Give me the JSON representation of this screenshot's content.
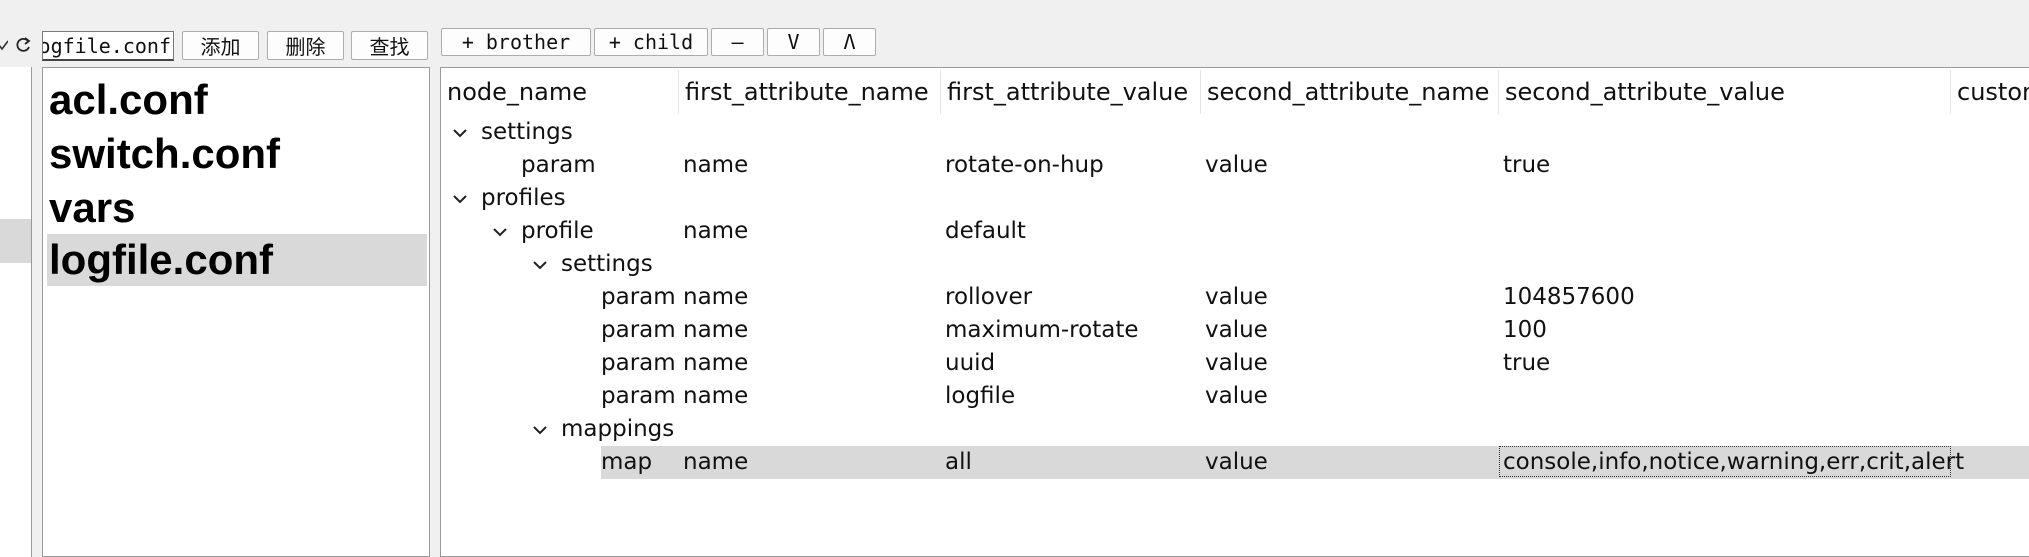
{
  "toolbar": {
    "file_input_value": "logfile.conf",
    "add_label": "添加",
    "delete_label": "删除",
    "find_label": "查找",
    "add_brother_label": "+ brother",
    "add_child_label": "+ child",
    "collapse_label": "—",
    "move_down_label": "V",
    "move_up_label": "Λ"
  },
  "file_list": {
    "items": [
      "acl.conf",
      "switch.conf",
      "vars",
      "logfile.conf"
    ],
    "selected": "logfile.conf"
  },
  "tree": {
    "columns": [
      "node_name",
      "first_attribute_name",
      "first_attribute_value",
      "second_attribute_name",
      "second_attribute_value",
      "custom"
    ],
    "rows": [
      {
        "depth": 0,
        "expandable": true,
        "node": "settings",
        "a1n": "",
        "a1v": "",
        "a2n": "",
        "a2v": ""
      },
      {
        "depth": 1,
        "expandable": false,
        "node": "param",
        "a1n": "name",
        "a1v": "rotate-on-hup",
        "a2n": "value",
        "a2v": "true"
      },
      {
        "depth": 0,
        "expandable": true,
        "node": "profiles",
        "a1n": "",
        "a1v": "",
        "a2n": "",
        "a2v": ""
      },
      {
        "depth": 1,
        "expandable": true,
        "node": "profile",
        "a1n": "name",
        "a1v": "default",
        "a2n": "",
        "a2v": ""
      },
      {
        "depth": 2,
        "expandable": true,
        "node": "settings",
        "a1n": "",
        "a1v": "",
        "a2n": "",
        "a2v": ""
      },
      {
        "depth": 3,
        "expandable": false,
        "node": "param",
        "a1n": "name",
        "a1v": "rollover",
        "a2n": "value",
        "a2v": "104857600"
      },
      {
        "depth": 3,
        "expandable": false,
        "node": "param",
        "a1n": "name",
        "a1v": "maximum-rotate",
        "a2n": "value",
        "a2v": "100"
      },
      {
        "depth": 3,
        "expandable": false,
        "node": "param",
        "a1n": "name",
        "a1v": "uuid",
        "a2n": "value",
        "a2v": "true"
      },
      {
        "depth": 3,
        "expandable": false,
        "node": "param",
        "a1n": "name",
        "a1v": "logfile",
        "a2n": "value",
        "a2v": ""
      },
      {
        "depth": 2,
        "expandable": true,
        "node": "mappings",
        "a1n": "",
        "a1v": "",
        "a2n": "",
        "a2v": ""
      },
      {
        "depth": 3,
        "expandable": false,
        "node": "map",
        "a1n": "name",
        "a1v": "all",
        "a2n": "value",
        "a2v": "console,info,notice,warning,err,crit,alert",
        "selected": true
      }
    ]
  },
  "icons": {
    "refresh": "refresh-icon",
    "expand": "chevron-down-icon"
  }
}
